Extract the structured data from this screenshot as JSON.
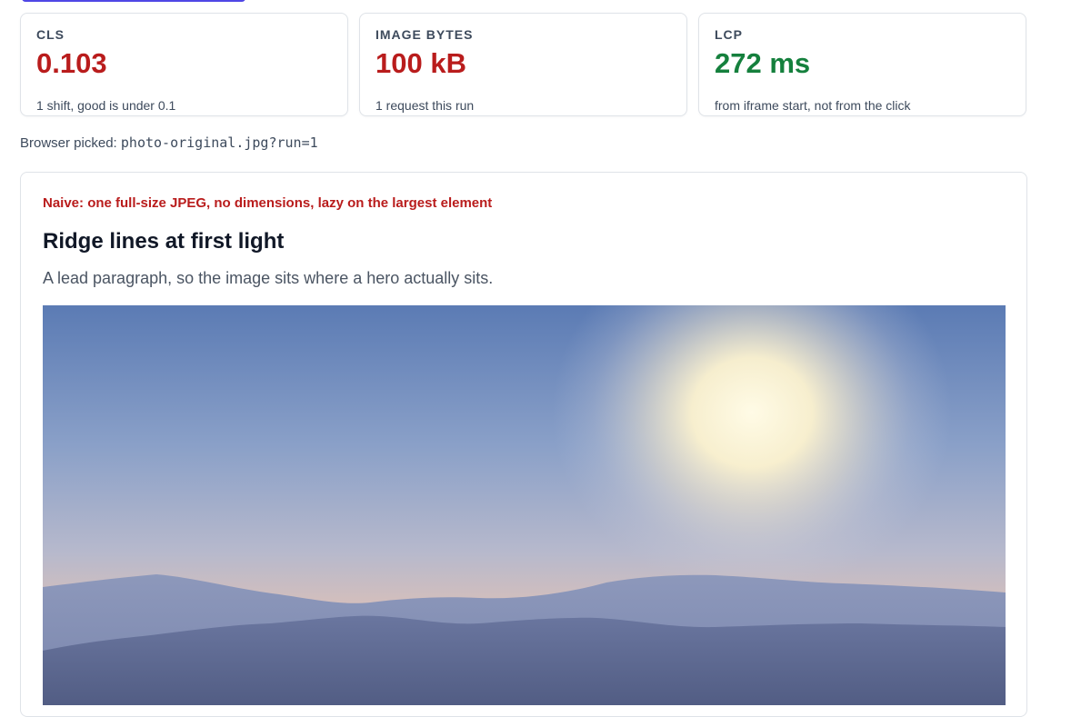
{
  "metrics": [
    {
      "label": "CLS",
      "value": "0.103",
      "note": "1 shift, good is under 0.1",
      "status": "bad"
    },
    {
      "label": "IMAGE BYTES",
      "value": "100 kB",
      "note": "1 request this run",
      "status": "bad"
    },
    {
      "label": "LCP",
      "value": "272 ms",
      "note": "from iframe start, not from the click",
      "status": "good"
    }
  ],
  "picked": {
    "prefix": "Browser picked:",
    "file": "photo-original.jpg?run=1"
  },
  "demo": {
    "tag": "Naive: one full-size JPEG, no dimensions, lazy on the largest element",
    "title": "Ridge lines at first light",
    "lead": "A lead paragraph, so the image sits where a hero actually sits.",
    "image_icon": "mountain-landscape-photo"
  },
  "colors": {
    "bad": "#b91c1c",
    "good": "#15803d",
    "accent": "#4f46e5",
    "border": "#dfe3e8"
  }
}
